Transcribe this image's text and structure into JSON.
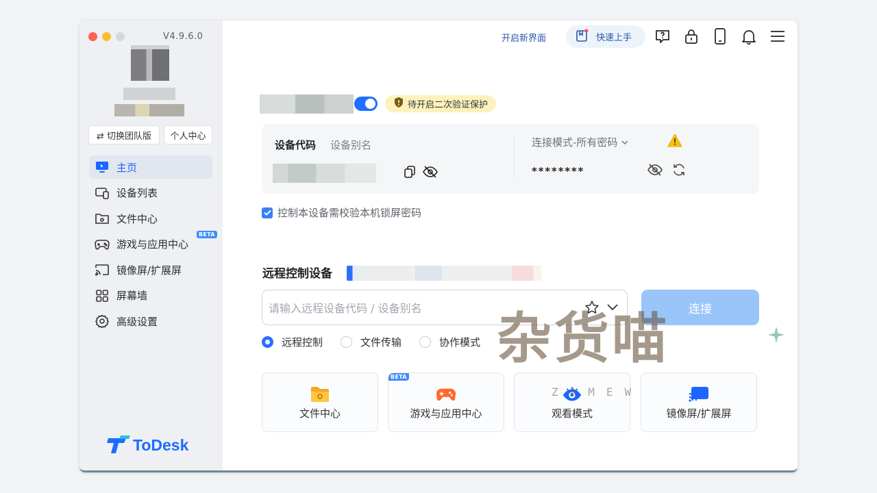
{
  "app": {
    "name": "ToDesk",
    "version": "V4.9.6.0"
  },
  "sidebar": {
    "switch_team_label": "⇄ 切换团队版",
    "personal_center_label": "个人中心",
    "items": [
      {
        "label": "主页",
        "icon": "monitor-icon",
        "active": true
      },
      {
        "label": "设备列表",
        "icon": "devices-icon"
      },
      {
        "label": "文件中心",
        "icon": "folder-icon"
      },
      {
        "label": "游戏与应用中心",
        "icon": "gamepad-icon",
        "badge": "BETA"
      },
      {
        "label": "镜像屏/扩展屏",
        "icon": "cast-icon"
      },
      {
        "label": "屏幕墙",
        "icon": "grid-icon"
      },
      {
        "label": "高级设置",
        "icon": "gear-icon"
      }
    ],
    "logo_text": "ToDesk"
  },
  "header": {
    "new_ui_link": "开启新界面",
    "quick_start": "快速上手",
    "icons": [
      "help-icon",
      "lock-icon",
      "phone-icon",
      "bell-icon",
      "menu-icon"
    ]
  },
  "device": {
    "two_factor_badge": "待开启二次验证保护",
    "code_label": "设备代码",
    "alias_label": "设备别名",
    "connect_mode": "连接模式-所有密码",
    "password_masked": "********",
    "lock_check_label": "控制本设备需校验本机锁屏密码",
    "lock_check_checked": true
  },
  "remote": {
    "title": "远程控制设备",
    "input_placeholder": "请输入远程设备代码 / 设备别名",
    "connect_label": "连接",
    "modes": [
      {
        "label": "远程控制",
        "selected": true
      },
      {
        "label": "文件传输",
        "selected": false
      },
      {
        "label": "协作模式",
        "selected": false
      }
    ]
  },
  "quick_cards": [
    {
      "label": "文件中心",
      "icon": "folder-icon"
    },
    {
      "label": "游戏与应用中心",
      "icon": "gamepad-icon",
      "badge": "BETA"
    },
    {
      "label": "观看模式",
      "icon": "eye-icon"
    },
    {
      "label": "镜像屏/扩展屏",
      "icon": "cast-icon"
    }
  ],
  "watermark": {
    "text": "杂货喵",
    "sub": "ZAMEW"
  },
  "colors": {
    "accent": "#1f6fff",
    "connect_disabled": "#9ac5fb",
    "badge_bg": "#fdf2bd",
    "sidebar_bg": "#eef0f3"
  }
}
